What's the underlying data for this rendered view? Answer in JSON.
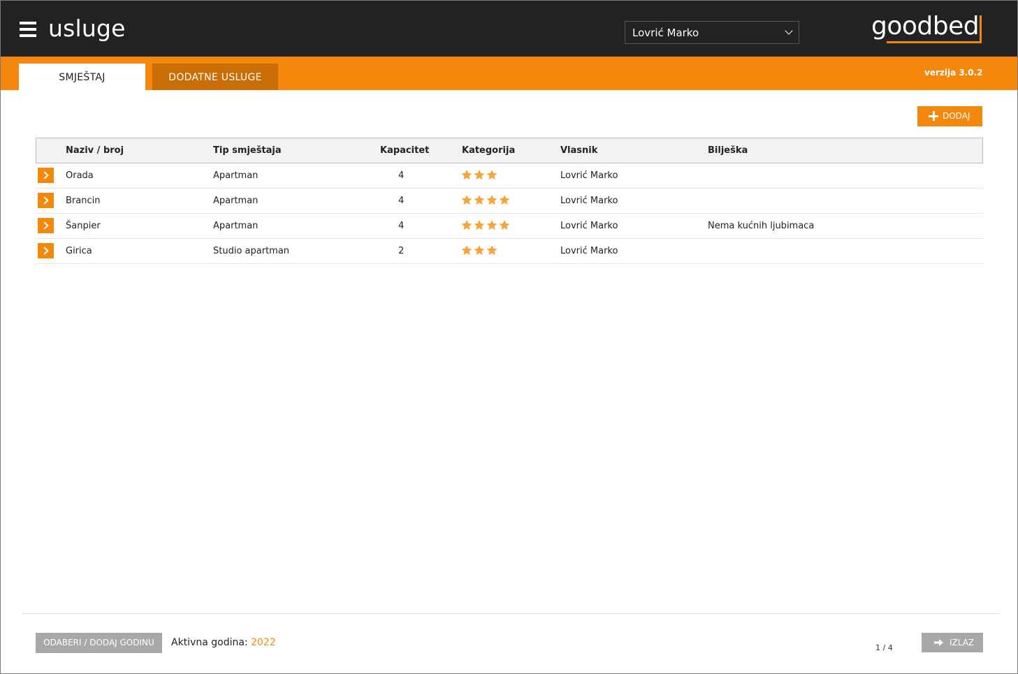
{
  "header": {
    "app_title": "usluge",
    "owner_selected": "Lovrić Marko",
    "logo_text": "goodbed"
  },
  "tabs": [
    {
      "label": "SMJEŠTAJ",
      "active": true
    },
    {
      "label": "DODATNE USLUGE",
      "active": false
    }
  ],
  "version": "verzija 3.0.2",
  "toolbar": {
    "add_label": "DODAJ"
  },
  "table": {
    "columns": [
      "Naziv / broj",
      "Tip smještaja",
      "Kapacitet",
      "Kategorija",
      "Vlasnik",
      "Bilješka"
    ],
    "rows": [
      {
        "name": "Orada",
        "type": "Apartman",
        "capacity": "4",
        "stars": 3,
        "owner": "Lovrić Marko",
        "note": ""
      },
      {
        "name": "Brancin",
        "type": "Apartman",
        "capacity": "4",
        "stars": 4,
        "owner": "Lovrić Marko",
        "note": ""
      },
      {
        "name": "Šanpier",
        "type": "Apartman",
        "capacity": "4",
        "stars": 4,
        "owner": "Lovrić Marko",
        "note": "Nema kućnih ljubimaca"
      },
      {
        "name": "Girica",
        "type": "Studio apartman",
        "capacity": "2",
        "stars": 3,
        "owner": "Lovrić Marko",
        "note": ""
      }
    ]
  },
  "footer": {
    "year_button_label": "ODABERI / DODAJ GODINU",
    "active_year_label": "Aktivna godina:",
    "active_year": "2022",
    "pagination": "1 / 4",
    "exit_label": "IZLAZ"
  },
  "colors": {
    "accent": "#f4880c",
    "topbar": "#222222",
    "tab_inactive": "#c96d06",
    "star": "#f7a43a",
    "button_gray": "#a8a8a8"
  }
}
